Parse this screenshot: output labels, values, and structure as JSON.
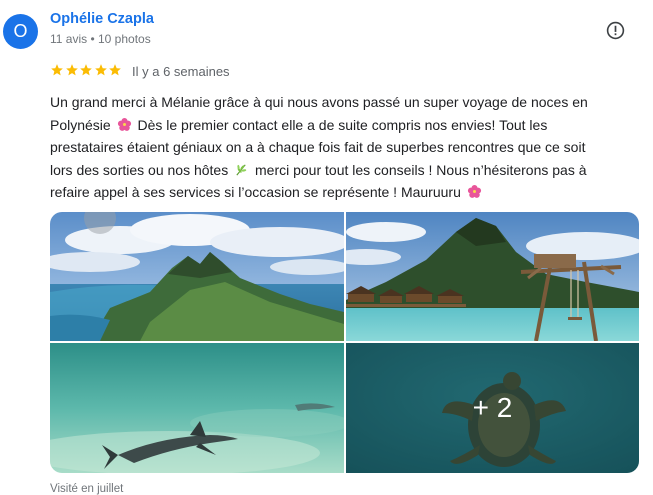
{
  "reviewer": {
    "initial": "O",
    "name": "Ophélie Czapla",
    "meta": "11 avis • 10 photos",
    "avatar_color": "#1a73e8"
  },
  "rating": {
    "stars": 5,
    "max": 5,
    "star_color": "#fbbc04",
    "date": "Il y a 6 semaines"
  },
  "review": {
    "part1": "Un grand merci à Mélanie grâce à qui nous avons passé un super voyage de noces en Polynésie",
    "part2": "Dès le premier contact elle a de suite compris nos envies! Tout les prestataires étaient géniaux on a à chaque fois fait de superbes rencontres que ce soit lors des sorties ou nos hôtes",
    "part3": "merci pour tout les conseils ! Nous n’hésiterons pas à refaire appel à ses services si l’occasion se représente ! Mauruuru",
    "emoji1": "hibiscus-emoji",
    "emoji2": "herb-emoji",
    "emoji3": "hibiscus-emoji"
  },
  "photos": {
    "items": [
      {
        "name": "photo-mountain-lagoon"
      },
      {
        "name": "photo-overwater-bungalows-swing"
      },
      {
        "name": "photo-shark-underwater"
      },
      {
        "name": "photo-turtle-underwater"
      }
    ],
    "more_label": "+ 2"
  },
  "footer": {
    "visited": "Visité en juillet"
  },
  "icons": {
    "report": "report-icon"
  }
}
